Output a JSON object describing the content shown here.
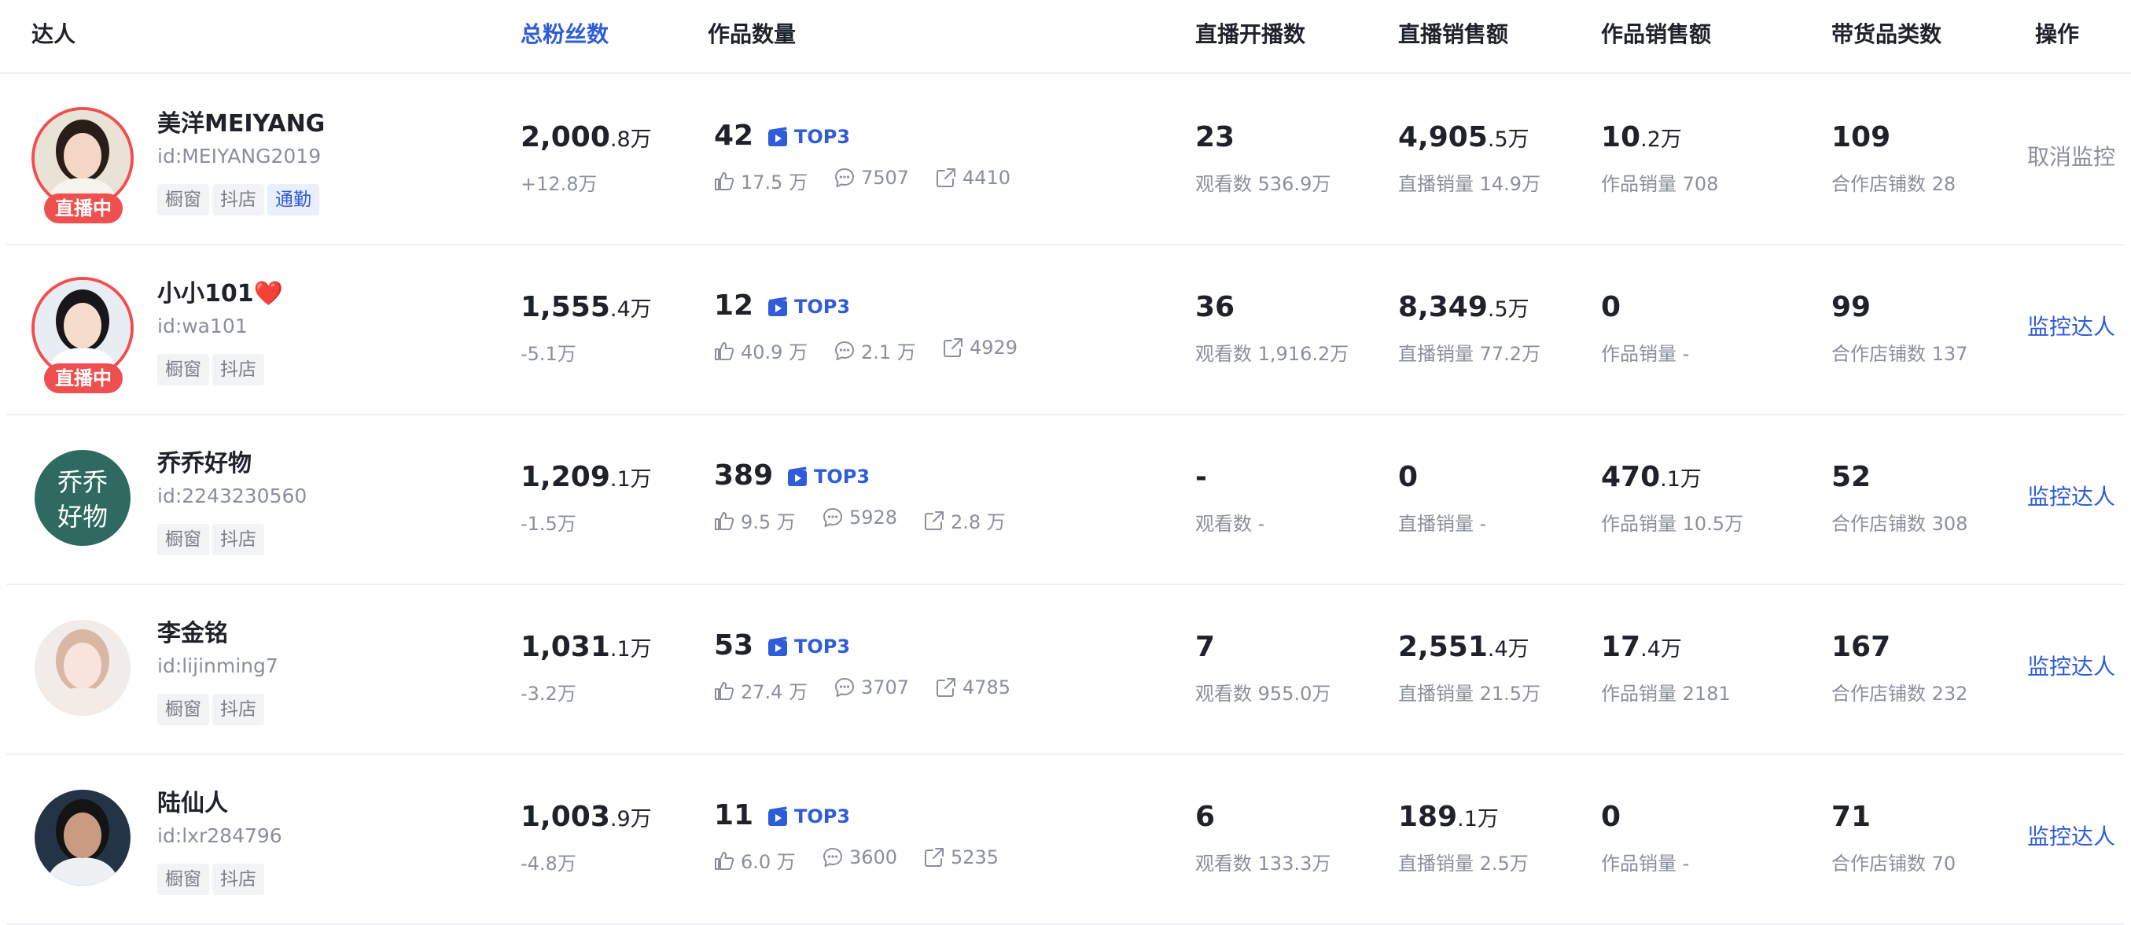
{
  "header": {
    "talent": "达人",
    "fans": "总粉丝数",
    "works": "作品数量",
    "live_count": "直播开播数",
    "live_sales": "直播销售额",
    "work_sales": "作品销售额",
    "categories": "带货品类数",
    "ops": "操作"
  },
  "rows": [
    {
      "name": "美洋MEIYANG",
      "id": "id:MEIYANG2019",
      "live_badge": "直播中",
      "tags": [
        "橱窗",
        "抖店",
        "通勤"
      ],
      "fans_main": "2,000",
      "fans_unit": ".8万",
      "fans_change": "+12.8万",
      "works_count": "42",
      "top3": "TOP3",
      "likes": "17.5 万",
      "comments": "7507",
      "shares": "4410",
      "live_count": "23",
      "live_views": "观看数 536.9万",
      "live_sales_main": "4,905",
      "live_sales_unit": ".5万",
      "live_volume": "直播销量 14.9万",
      "work_sales_main": "10",
      "work_sales_unit": ".2万",
      "work_volume": "作品销量 708",
      "category_count": "109",
      "shops": "合作店铺数 28",
      "action": "取消监控"
    },
    {
      "name": "小小101❤️",
      "id": "id:wa101",
      "live_badge": "直播中",
      "tags": [
        "橱窗",
        "抖店"
      ],
      "fans_main": "1,555",
      "fans_unit": ".4万",
      "fans_change": "-5.1万",
      "works_count": "12",
      "top3": "TOP3",
      "likes": "40.9 万",
      "comments": "2.1 万",
      "shares": "4929",
      "live_count": "36",
      "live_views": "观看数 1,916.2万",
      "live_sales_main": "8,349",
      "live_sales_unit": ".5万",
      "live_volume": "直播销量 77.2万",
      "work_sales_main": "0",
      "work_sales_unit": "",
      "work_volume": "作品销量 -",
      "category_count": "99",
      "shops": "合作店铺数 137",
      "action": "监控达人"
    },
    {
      "name": "乔乔好物",
      "id": "id:2243230560",
      "live_badge": "",
      "avatar_text": "乔乔好物",
      "tags": [
        "橱窗",
        "抖店"
      ],
      "fans_main": "1,209",
      "fans_unit": ".1万",
      "fans_change": "-1.5万",
      "works_count": "389",
      "top3": "TOP3",
      "likes": "9.5 万",
      "comments": "5928",
      "shares": "2.8 万",
      "live_count": "-",
      "live_views": "观看数 -",
      "live_sales_main": "0",
      "live_sales_unit": "",
      "live_volume": "直播销量 -",
      "work_sales_main": "470",
      "work_sales_unit": ".1万",
      "work_volume": "作品销量 10.5万",
      "category_count": "52",
      "shops": "合作店铺数 308",
      "action": "监控达人"
    },
    {
      "name": "李金铭",
      "id": "id:lijinming7",
      "live_badge": "",
      "tags": [
        "橱窗",
        "抖店"
      ],
      "fans_main": "1,031",
      "fans_unit": ".1万",
      "fans_change": "-3.2万",
      "works_count": "53",
      "top3": "TOP3",
      "likes": "27.4 万",
      "comments": "3707",
      "shares": "4785",
      "live_count": "7",
      "live_views": "观看数 955.0万",
      "live_sales_main": "2,551",
      "live_sales_unit": ".4万",
      "live_volume": "直播销量 21.5万",
      "work_sales_main": "17",
      "work_sales_unit": ".4万",
      "work_volume": "作品销量 2181",
      "category_count": "167",
      "shops": "合作店铺数 232",
      "action": "监控达人"
    },
    {
      "name": "陆仙人",
      "id": "id:lxr284796",
      "live_badge": "",
      "tags": [
        "橱窗",
        "抖店"
      ],
      "fans_main": "1,003",
      "fans_unit": ".9万",
      "fans_change": "-4.8万",
      "works_count": "11",
      "top3": "TOP3",
      "likes": "6.0 万",
      "comments": "3600",
      "shares": "5235",
      "live_count": "6",
      "live_views": "观看数 133.3万",
      "live_sales_main": "189",
      "live_sales_unit": ".1万",
      "live_volume": "直播销量 2.5万",
      "work_sales_main": "0",
      "work_sales_unit": "",
      "work_volume": "作品销量 -",
      "category_count": "71",
      "shops": "合作店铺数 70",
      "action": "监控达人"
    }
  ],
  "icons": {
    "top3": "video-clip-icon",
    "likes": "thumb-up-icon",
    "comments": "comment-bubble-icon",
    "shares": "share-arrow-icon"
  },
  "colors": {
    "accent": "#2f5cd8",
    "live": "#ef4f4f",
    "muted": "#8a8f99"
  }
}
